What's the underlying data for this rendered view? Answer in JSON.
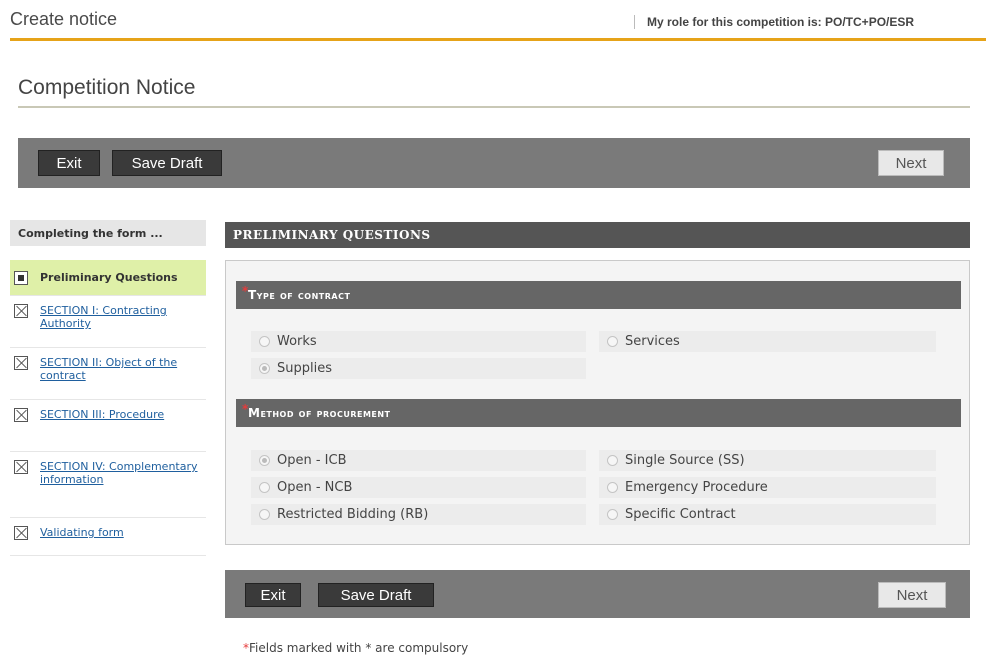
{
  "header": {
    "title": "Create notice",
    "role_text": "My role for this competition is: PO/TC+PO/ESR"
  },
  "page_title": "Competition Notice",
  "toolbar": {
    "exit_label": "Exit",
    "save_draft_label": "Save Draft",
    "next_label": "Next"
  },
  "sidebar": {
    "heading": "Completing the form ...",
    "items": [
      {
        "label": "Preliminary Questions",
        "state": "current"
      },
      {
        "label": "SECTION I: Contracting Authority",
        "state": "incomplete"
      },
      {
        "label": "SECTION II: Object of the contract",
        "state": "incomplete"
      },
      {
        "label": "SECTION III: Procedure",
        "state": "incomplete"
      },
      {
        "label": "SECTION IV: Complementary information",
        "state": "incomplete"
      },
      {
        "label": "Validating form",
        "state": "incomplete"
      }
    ]
  },
  "panel": {
    "title": "PRELIMINARY QUESTIONS",
    "type_of_contract": {
      "star": "*",
      "label": "Type of contract",
      "options": [
        {
          "label": "Works",
          "selected": false
        },
        {
          "label": "Services",
          "selected": false
        },
        {
          "label": "Supplies",
          "selected": true
        }
      ]
    },
    "method_of_procurement": {
      "star": "*",
      "label": "Method of procurement",
      "options": [
        {
          "label": "Open - ICB",
          "selected": true
        },
        {
          "label": "Single Source (SS)",
          "selected": false
        },
        {
          "label": "Open - NCB",
          "selected": false
        },
        {
          "label": "Emergency Procedure",
          "selected": false
        },
        {
          "label": "Restricted Bidding (RB)",
          "selected": false
        },
        {
          "label": "Specific Contract",
          "selected": false
        }
      ]
    }
  },
  "footnote": {
    "star": "*",
    "text": "Fields marked with * are compulsory"
  }
}
